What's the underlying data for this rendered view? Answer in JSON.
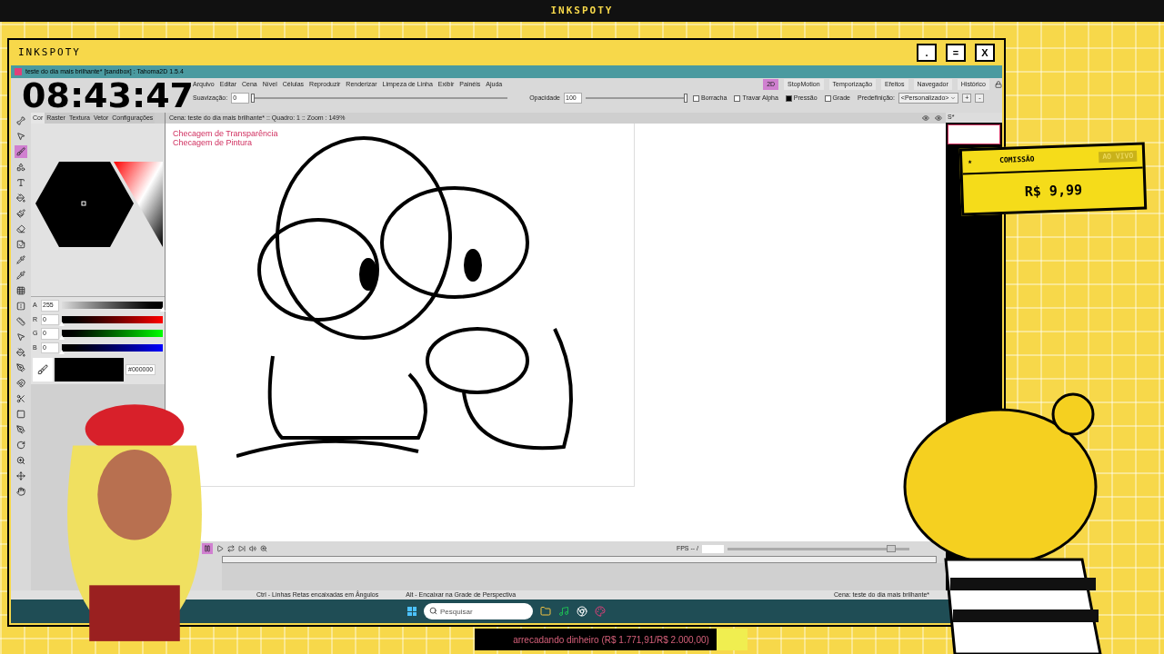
{
  "overlay_title": "INKSPOTY",
  "window": {
    "title": "INKSPOTY",
    "buttons": [
      ".",
      "=",
      "X"
    ]
  },
  "clock": "08:43:47",
  "app": {
    "title": "teste do dia mais brilhante* [sandbox] : Tahoma2D 1.5.4",
    "menu": [
      "Arquivo",
      "Editar",
      "Cena",
      "Nível",
      "Células",
      "Reproduzir",
      "Renderizar",
      "Limpeza de Linha",
      "Exibir",
      "Painéis",
      "Ajuda"
    ],
    "rooms": [
      {
        "label": "2D",
        "selected": true
      },
      {
        "label": "StopMotion",
        "selected": false
      },
      {
        "label": "Temporização",
        "selected": false
      },
      {
        "label": "Efeitos",
        "selected": false
      },
      {
        "label": "Navegador",
        "selected": false
      },
      {
        "label": "Histórico",
        "selected": false
      }
    ],
    "options": {
      "smoothing": {
        "label": "Suavização:",
        "value": "0",
        "level": 0
      },
      "opacity": {
        "label": "Opacidade",
        "value": "100",
        "level": 1
      },
      "checkboxes": [
        {
          "label": "Borracha",
          "checked": false
        },
        {
          "label": "Travar Alpha",
          "checked": false
        },
        {
          "label": "Pressão",
          "checked": true
        },
        {
          "label": "Grade",
          "checked": false
        }
      ],
      "preset_label": "Predefinição:",
      "preset_value": "<Personalizado>",
      "preset_buttons": [
        "+",
        "-"
      ]
    },
    "tools": [
      {
        "kind": "skeleton",
        "selected": false
      },
      {
        "kind": "pointer",
        "selected": false
      },
      {
        "kind": "brush",
        "selected": true
      },
      {
        "kind": "shapes",
        "selected": false
      },
      {
        "kind": "text",
        "selected": false
      },
      {
        "kind": "bucket",
        "selected": false
      },
      {
        "kind": "paint",
        "selected": false
      },
      {
        "kind": "eraser",
        "selected": false
      },
      {
        "kind": "tape",
        "selected": false
      },
      {
        "kind": "eyedropper",
        "selected": false
      },
      {
        "kind": "picker",
        "selected": false
      },
      {
        "kind": "grid",
        "selected": false
      },
      {
        "kind": "mirror",
        "selected": false
      },
      {
        "kind": "ruler",
        "selected": false
      },
      {
        "kind": "pointer",
        "selected": false
      },
      {
        "kind": "bucket",
        "selected": false
      },
      {
        "kind": "pen",
        "selected": false
      },
      {
        "kind": "magnet",
        "selected": false
      },
      {
        "kind": "scissors",
        "selected": false
      },
      {
        "kind": "iron",
        "selected": false
      },
      {
        "kind": "pen",
        "selected": false
      },
      {
        "kind": "rotate",
        "selected": false
      },
      {
        "kind": "zoom",
        "selected": false
      },
      {
        "kind": "move",
        "selected": false
      },
      {
        "kind": "hand",
        "selected": false
      }
    ],
    "color_panel": {
      "tabs": [
        {
          "label": "Cor",
          "selected": true
        },
        {
          "label": "Raster",
          "selected": false
        },
        {
          "label": "Textura",
          "selected": false
        },
        {
          "label": "Vetor",
          "selected": false
        },
        {
          "label": "Configurações",
          "selected": false
        }
      ],
      "channels": [
        {
          "name": "A",
          "value": "255",
          "level": 1
        },
        {
          "name": "R",
          "value": "0",
          "level": 0
        },
        {
          "name": "G",
          "value": "0",
          "level": 0
        },
        {
          "name": "B",
          "value": "0",
          "level": 0
        }
      ],
      "hex": "#000000"
    },
    "viewer": {
      "header": "Cena: teste do dia mais brilhante*  ::  Quadro: 1  ::  Zoom : 149%",
      "canvas_notes": [
        "Checagem de Transparência",
        "Checagem de Pintura"
      ]
    },
    "right_panel": {
      "tab": "S*"
    },
    "timeline": {
      "paused": true,
      "fps_label": "FPS -- /",
      "fps_slider": {
        "level": 0.9
      }
    },
    "status_bar": [
      "Ctrl - Linhas Retas encaixadas em Ângulos",
      "Alt - Encaixar na Grade de Perspectiva",
      "Cena: teste do dia mais brilhante*"
    ]
  },
  "taskbar": {
    "search_placeholder": "Pesquisar"
  },
  "commission": {
    "star": "★",
    "title": "COMISSÃO",
    "badge": "AO VIVO",
    "amount": "R$ 9,99"
  },
  "goal": {
    "text": "arrecadando dinheiro (R$ 1.771,91/R$ 2.000,00)",
    "level": 0.886
  }
}
